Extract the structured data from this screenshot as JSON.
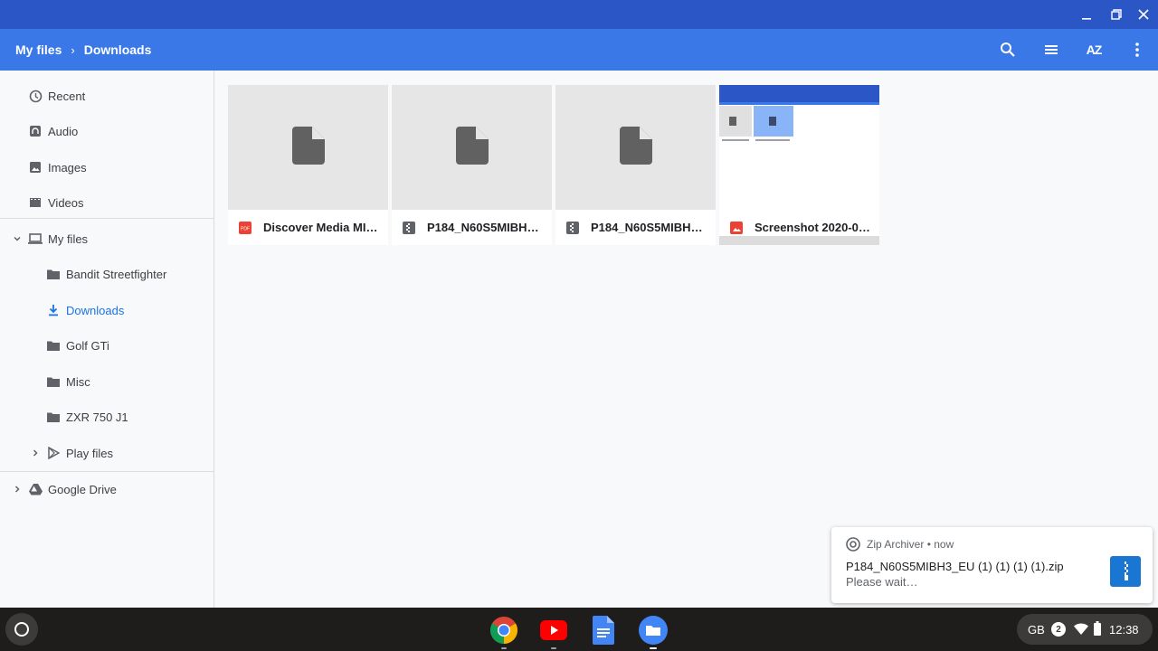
{
  "breadcrumb": {
    "root": "My files",
    "current": "Downloads"
  },
  "toolbar": {
    "sort_label": "AZ"
  },
  "sidebar": {
    "items": [
      {
        "label": "Recent"
      },
      {
        "label": "Audio"
      },
      {
        "label": "Images"
      },
      {
        "label": "Videos"
      },
      {
        "label": "My files"
      },
      {
        "label": "Bandit Streetfighter"
      },
      {
        "label": "Downloads"
      },
      {
        "label": "Golf GTi"
      },
      {
        "label": "Misc"
      },
      {
        "label": "ZXR 750 J1"
      },
      {
        "label": "Play files"
      },
      {
        "label": "Google Drive"
      }
    ]
  },
  "files": [
    {
      "name": "Discover Media MIB…",
      "type": "pdf-icon"
    },
    {
      "name": "P184_N60S5MIBH3…",
      "type": "zip-icon"
    },
    {
      "name": "P184_N60S5MIBH3…",
      "type": "zip-icon"
    },
    {
      "name": "Screenshot 2020-04…",
      "type": "image-icon"
    }
  ],
  "notification": {
    "source": "Zip Archiver",
    "time": "now",
    "title": "P184_N60S5MIBH3_EU (1) (1) (1) (1).zip",
    "message": "Please wait…"
  },
  "tray": {
    "keyboard": "GB",
    "badge": "2",
    "time": "12:38"
  },
  "colors": {
    "accent": "#3b78e7",
    "titlebar": "#2a56c6",
    "active": "#1a73e8"
  }
}
